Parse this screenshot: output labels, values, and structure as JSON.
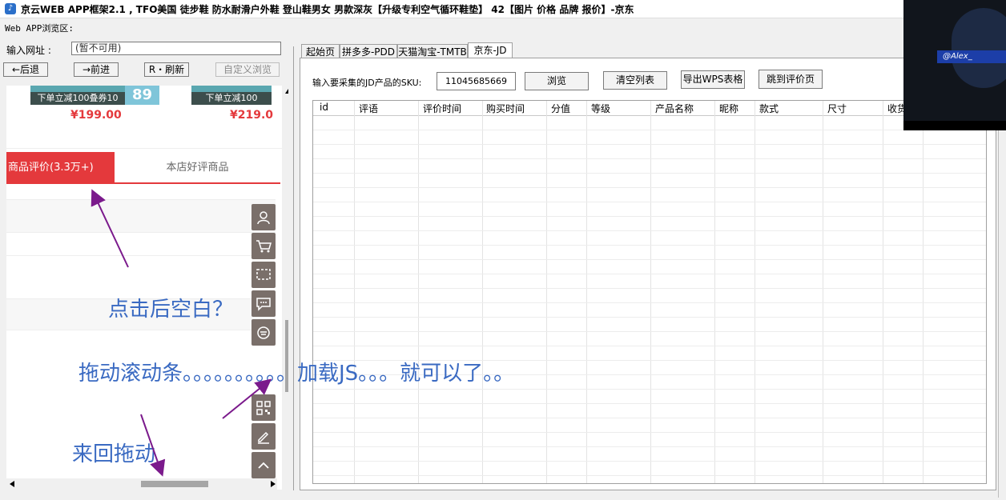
{
  "window": {
    "title": "京云WEB APP框架2.1 , TFO美国 徒步鞋 防水耐滑户外鞋 登山鞋男女 男款深灰【升级专利空气循环鞋垫】 42【图片 价格 品牌 报价】-京东",
    "icon_glyph": "♪"
  },
  "left": {
    "section_label": "Web APP浏览区:",
    "url_label": "输入网址 :",
    "url_placeholder": "(暂不可用)",
    "buttons": {
      "back": "←后退",
      "forward": "→前进",
      "refresh": "R・刷新",
      "custom": "自定义浏览"
    },
    "webview": {
      "products": [
        {
          "banner": "下单立减100叠券10",
          "badge": "89",
          "price": "¥199.00"
        },
        {
          "banner": "下单立减100",
          "price": "¥219.0"
        }
      ],
      "tabs": {
        "active": "商品评价(3.3万+)",
        "inactive": "本店好评商品"
      }
    }
  },
  "right": {
    "tabs": [
      "起始页",
      "拼多多-PDD",
      "天猫淘宝-TMTB",
      "京东-JD"
    ],
    "selected_tab": "京东-JD",
    "sku_label": "输入要采集的JD产品的SKU:",
    "sku_value": "11045685669",
    "buttons": {
      "browse": "浏览",
      "clear": "清空列表",
      "export": "导出WPS表格",
      "jump": "跳到评价页"
    },
    "grid_columns": [
      "id",
      "评语",
      "评价时间",
      "购买时间",
      "分值",
      "等级",
      "产品名称",
      "昵称",
      "款式",
      "尺寸",
      "收货"
    ]
  },
  "overlay": {
    "watermark": "@Alex_"
  },
  "annotations": {
    "blank_question": "点击后空白？",
    "drag_scrollbar": "拖动滚动条。。。。。。。。。。加载JS。。。就可以了。。",
    "drag_back_forth": "来回拖动"
  },
  "colors": {
    "accent_red": "#e4393c",
    "annotation_blue": "#3a6ac2",
    "arrow_purple": "#7b1a8c"
  }
}
